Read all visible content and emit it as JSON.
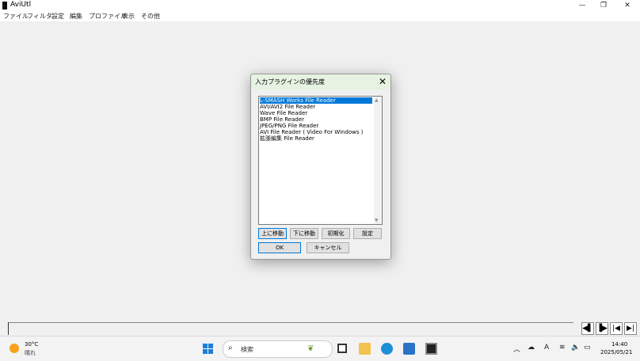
{
  "window": {
    "title": "AviUtl",
    "minimize_icon": "minimize-icon",
    "maximize_icon": "restore-icon",
    "close_icon": "close-icon"
  },
  "menu": [
    "ファイル",
    "フィルタ",
    "設定",
    "編集",
    "プロファイル",
    "表示",
    "その他"
  ],
  "dialog": {
    "title": "入力プラグインの優先度",
    "close_glyph": "✕",
    "list_items": [
      "L-SMASH Works File Reader",
      "AVI/AVI2 File Reader",
      "Wave File Reader",
      "BMP File Reader",
      "JPEG/PNG File Reader",
      "AVI File Reader ( Video For Windows )",
      "拡張編集 File Reader"
    ],
    "selected_index": 0,
    "buttons": {
      "move_up": "上に移動",
      "move_down": "下に移動",
      "reset": "初期化",
      "settings": "設定",
      "ok": "OK",
      "cancel": "キャンセル"
    }
  },
  "playback": {
    "icons": [
      "play-back-icon",
      "play-forward-icon",
      "skip-start-icon",
      "skip-end-icon"
    ]
  },
  "taskbar": {
    "weather": {
      "temp": "30°C",
      "condition": "晴れ"
    },
    "search_placeholder": "検索",
    "clock": {
      "time": "14:40",
      "date": "2025/05/21"
    },
    "ime": "A"
  }
}
